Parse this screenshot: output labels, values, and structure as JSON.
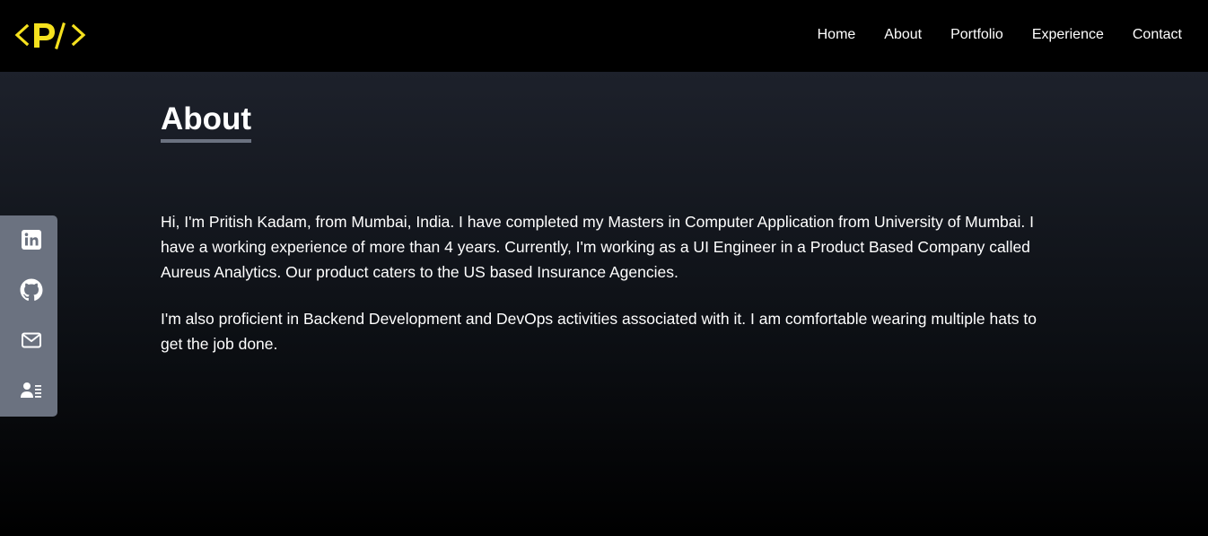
{
  "brand": {
    "logo_text": "<P/>",
    "logo_color": "#f5e11e"
  },
  "nav": {
    "items": [
      {
        "label": "Home"
      },
      {
        "label": "About"
      },
      {
        "label": "Portfolio"
      },
      {
        "label": "Experience"
      },
      {
        "label": "Contact"
      }
    ]
  },
  "about": {
    "title": "About",
    "paragraphs": [
      "Hi, I'm Pritish Kadam, from Mumbai, India. I have completed my Masters in Computer Application from University of Mumbai. I have a working experience of more than 4 years. Currently, I'm working as a UI Engineer in a Product Based Company called Aureus Analytics. Our product caters to the US based Insurance Agencies.",
      "I'm also proficient in Backend Development and DevOps activities associated with it. I am comfortable wearing multiple hats to get the job done."
    ]
  },
  "social": {
    "items": [
      {
        "icon": "linkedin-icon"
      },
      {
        "icon": "github-icon"
      },
      {
        "icon": "mail-icon"
      },
      {
        "icon": "resume-icon"
      }
    ]
  },
  "colors": {
    "accent": "#f5e11e",
    "social_bar": "#6b7280",
    "title_underline": "#6b7280",
    "header_bg": "#000000",
    "section_gradient_top": "#1d212b"
  }
}
